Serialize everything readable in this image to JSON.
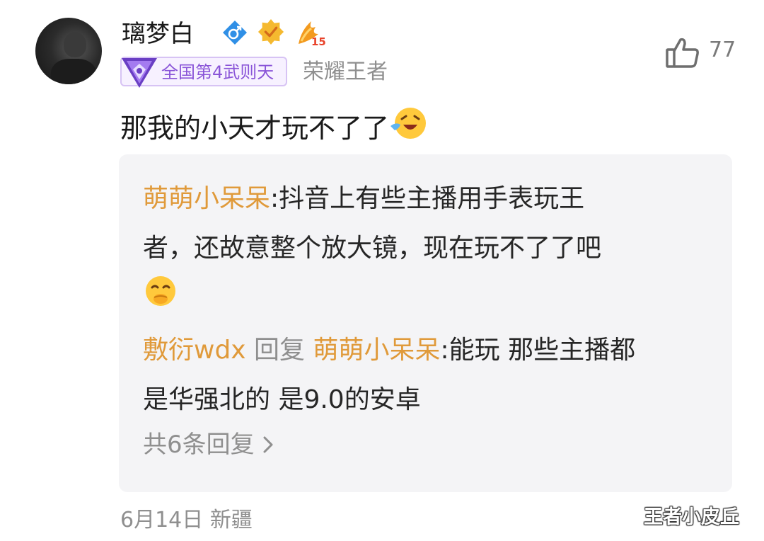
{
  "user": {
    "name": "璃梦白",
    "gender_icon": "male-icon",
    "verified_icon": "verified-badge-icon",
    "level": "15",
    "rank_tag": "全国第4武则天",
    "rank_title": "荣耀王者"
  },
  "likes": {
    "icon": "thumbs-up-icon",
    "count": "77"
  },
  "comment": {
    "text": "那我的小天才玩不了了",
    "emoji": "crying-laughing-emoji"
  },
  "replies": [
    {
      "author": "萌萌小呆呆",
      "separator": ":",
      "text_line1": "抖音上有些主播用手表玩王",
      "text_line2": "者，还故意整个放大镜，现在玩不了了吧",
      "emoji": "giggle-emoji"
    },
    {
      "author": "敷衍wdx",
      "reply_word": " 回复 ",
      "reply_to": "萌萌小呆呆",
      "separator": ":",
      "text_line1": "能玩 那些主播都",
      "text_line2": "是华强北的 是9.0的安卓"
    }
  ],
  "more_replies": "共6条回复",
  "meta": {
    "date": "6月14日",
    "location": "新疆"
  },
  "watermark": "王者小皮丘",
  "colors": {
    "name_orange": "#e09a3a",
    "rank_purple": "#8a55d8",
    "gray_text": "#8f8f8f",
    "reply_bg": "#f4f4f6"
  }
}
